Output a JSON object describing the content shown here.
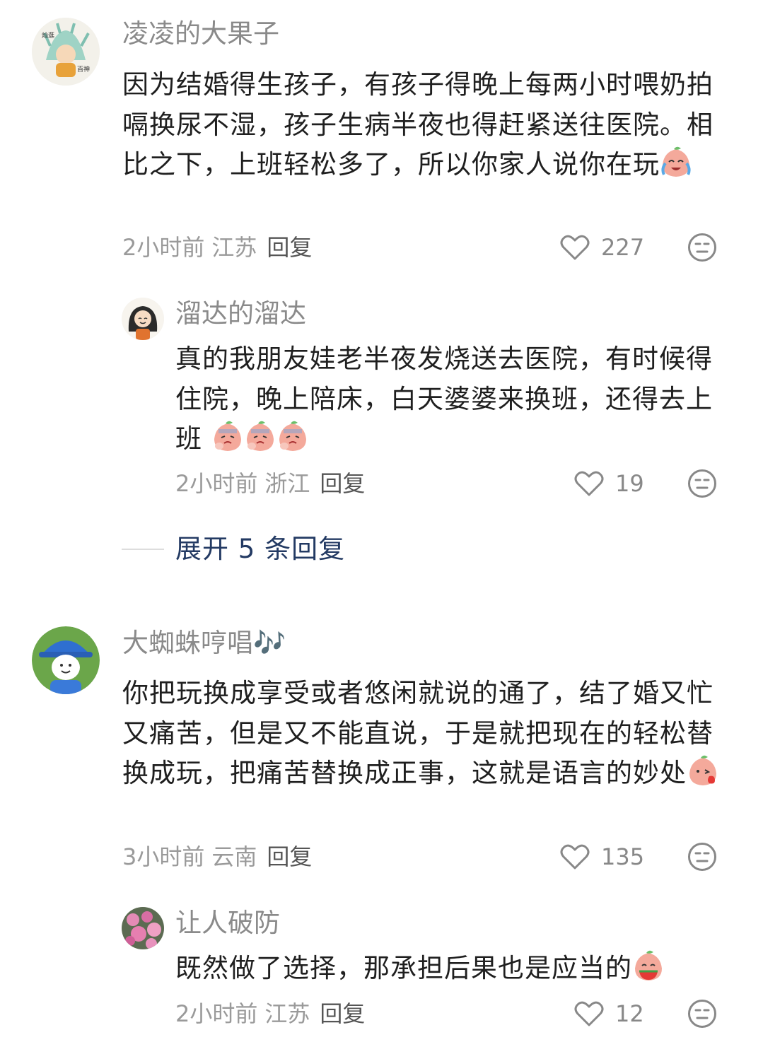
{
  "comments": [
    {
      "username": "凌凌的大果子",
      "avatar_text": [
        "灿逛",
        "百神"
      ],
      "text": "因为结婚得生孩子，有孩子得晚上每两小时喂奶拍嗝换尿不湿，孩子生病半夜也得赶紧送往医院。相比之下，上班轻松多了，所以你家人说你在玩",
      "emoji": "crying-peach-emoji",
      "time": "2小时前",
      "location": "江苏",
      "reply_label": "回复",
      "likes": "227",
      "replies": [
        {
          "username": "溜达的溜达",
          "text": "真的我朋友娃老半夜发烧送去医院，有时候得住院，晚上陪床，白天婆婆来换班，还得去上班",
          "emoji": "worried-peach-emoji x3",
          "time": "2小时前",
          "location": "浙江",
          "reply_label": "回复",
          "likes": "19"
        }
      ],
      "expand_label": "展开 5 条回复"
    },
    {
      "username": "大蜘蛛哼唱",
      "username_suffix": "🎶",
      "text": "你把玩换成享受或者悠闲就说的通了，结了婚又忙又痛苦，但是又不能直说，于是就把现在的轻松替换成玩，把痛苦替换成正事，这就是语言的妙处",
      "emoji": "kiss-peach-emoji",
      "time": "3小时前",
      "location": "云南",
      "reply_label": "回复",
      "likes": "135",
      "replies": [
        {
          "username": "让人破防",
          "text": "既然做了选择，那承担后果也是应当的",
          "emoji": "watermelon-peach-emoji",
          "time": "2小时前",
          "location": "江苏",
          "reply_label": "回复",
          "likes": "12"
        }
      ]
    }
  ],
  "colors": {
    "username": "#8a8a8a",
    "text": "#1f1f1f",
    "meta": "#9a9a9a",
    "expand": "#233a63",
    "peach": "#f4a99b"
  }
}
